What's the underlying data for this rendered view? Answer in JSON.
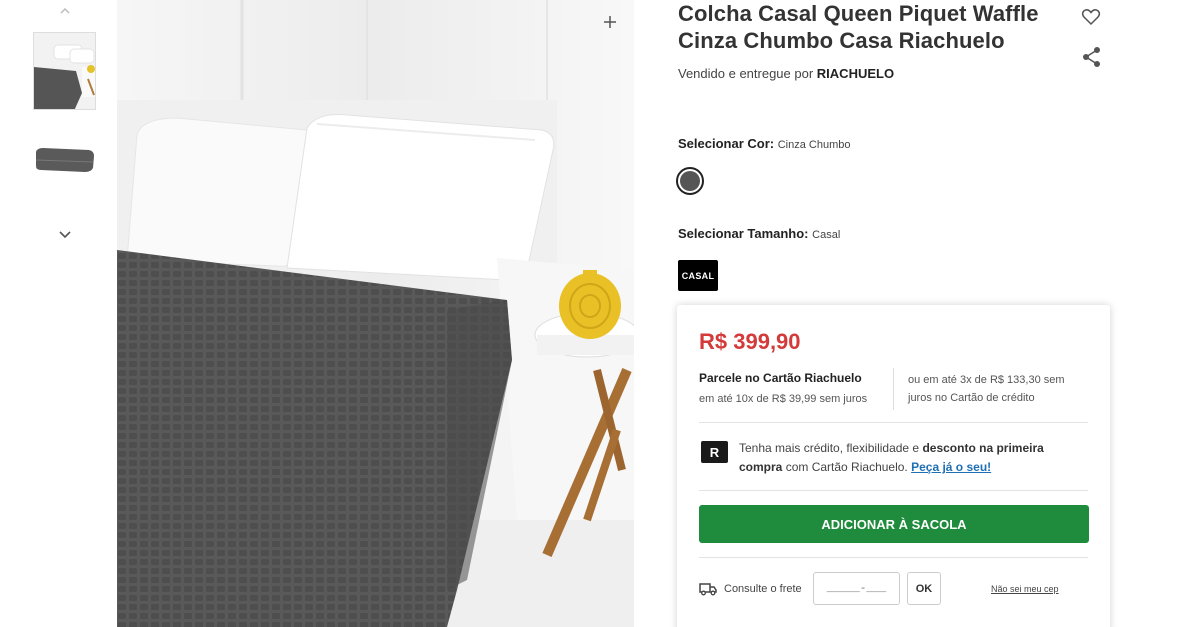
{
  "product": {
    "title": "Colcha Casal Queen Piquet Waffle Cinza Chumbo Casa Riachuelo",
    "seller_prefix": "Vendido e entregue por",
    "seller_name": "RIACHUELO"
  },
  "color_select": {
    "label": "Selecionar Cor:",
    "value": "Cinza Chumbo",
    "swatch_color": "#555555"
  },
  "size_select": {
    "label": "Selecionar Tamanho:",
    "value": "Casal",
    "option": "CASAL"
  },
  "price_card": {
    "price": "R$ 399,90",
    "installment_title": "Parcele no Cartão Riachuelo",
    "installment_detail": "em até 10x de R$ 39,99 sem juros",
    "installment_other": "ou em até 3x de R$ 133,30 sem juros no Cartão de crédito",
    "promo_logo": "R",
    "promo_text_1": "Tenha mais crédito, flexibilidade e",
    "promo_bold_1": "desconto na primeira compra",
    "promo_text_2": "com Cartão Riachuelo.",
    "promo_link": "Peça já o seu!",
    "add_button": "ADICIONAR À SACOLA",
    "shipping_label": "Consulte o frete",
    "cep_placeholder": "_____-___",
    "ok_button": "OK",
    "no_cep_link": "Não sei meu cep"
  },
  "colors": {
    "price_red": "#d43a3a",
    "add_button_green": "#1f8b3d",
    "link_blue": "#1f6fb5"
  },
  "icons": {
    "thumb_up": "chevron-up-icon",
    "thumb_down": "chevron-down-icon",
    "zoom": "plus-icon",
    "favorite": "heart-icon",
    "share": "share-icon",
    "shipping": "truck-icon"
  }
}
